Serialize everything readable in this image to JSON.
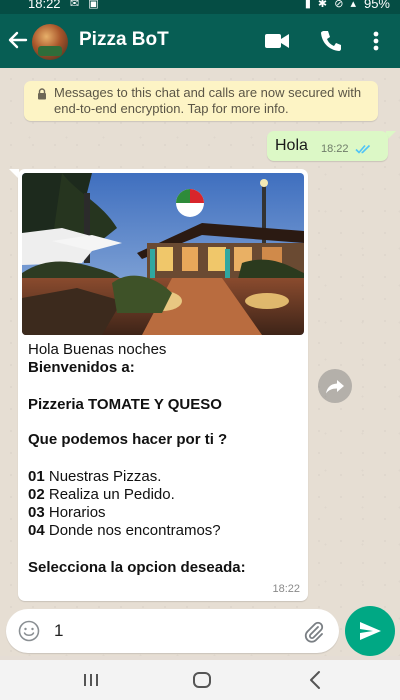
{
  "status_bar": {
    "time": "18:22",
    "battery": "95%"
  },
  "header": {
    "contact_name": "Pizza BoT"
  },
  "chat": {
    "encryption_notice": "Messages to this chat and calls are now secured with end-to-end encryption. Tap for more info.",
    "outgoing": {
      "text": "Hola",
      "time": "18:22"
    },
    "incoming": {
      "greeting": "Hola Buenas noches",
      "welcome": "Bienvenidos a:",
      "restaurant": "Pizzeria TOMATE Y QUESO",
      "question": "Que podemos hacer por ti ?",
      "options": [
        {
          "num": "01",
          "label": "Nuestras Pizzas."
        },
        {
          "num": "02",
          "label": "Realiza un Pedido."
        },
        {
          "num": "03",
          "label": "Horarios"
        },
        {
          "num": "04",
          "label": "Donde nos encontramos?"
        }
      ],
      "prompt": "Selecciona la opcion deseada:",
      "time": "18:22"
    }
  },
  "composer": {
    "value": "1"
  },
  "colors": {
    "header": "#075e54",
    "status_bar": "#054d44",
    "outgoing_bubble": "#dcf8c6",
    "send_button": "#00a884",
    "read_ticks": "#4fc3f7"
  },
  "icons": [
    "back-arrow-icon",
    "video-call-icon",
    "phone-icon",
    "more-vert-icon",
    "lock-icon",
    "double-check-icon",
    "forward-icon",
    "emoji-icon",
    "attach-icon",
    "send-icon",
    "recent-apps-icon",
    "home-icon",
    "nav-back-icon"
  ]
}
